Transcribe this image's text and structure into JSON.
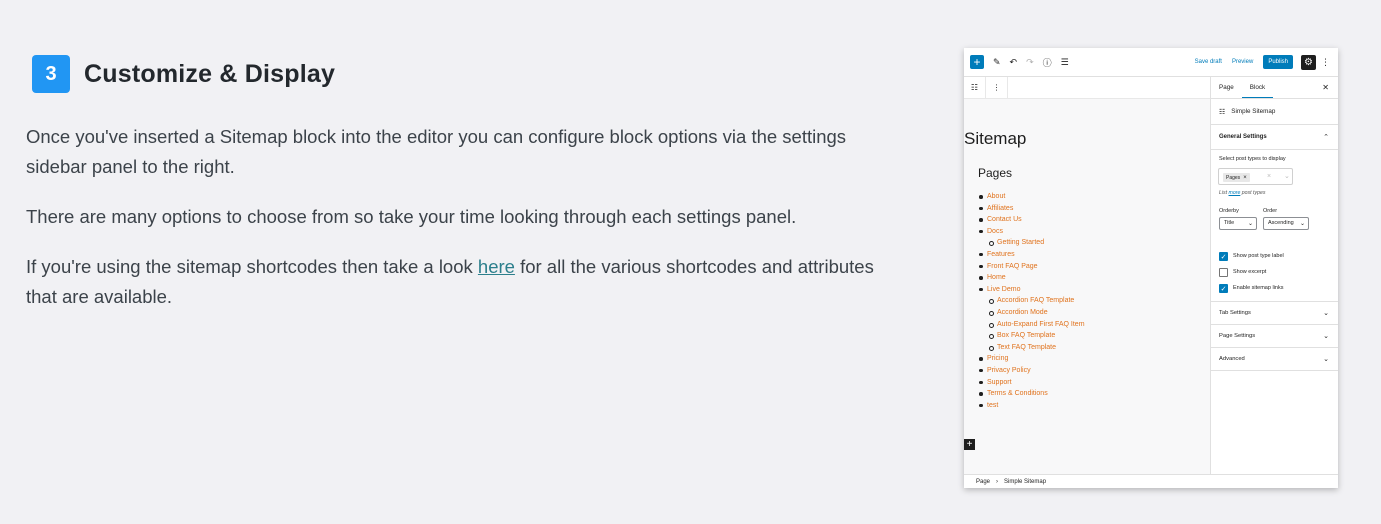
{
  "step": {
    "number": "3",
    "title": "Customize & Display"
  },
  "article": {
    "p1": "Once you've inserted a Sitemap block into the editor you can configure block options via the settings sidebar panel to the right.",
    "p2": "There are many options to choose from so take your time looking through each settings panel.",
    "p3_before": "If you're using the sitemap shortcodes then take a look ",
    "p3_link": "here",
    "p3_after": " for all the various shortcodes and attributes that are available."
  },
  "editor": {
    "toolbar": {
      "save_draft": "Save draft",
      "preview": "Preview",
      "publish": "Publish"
    },
    "canvas": {
      "title": "Sitemap",
      "subtitle": "Pages",
      "items": [
        {
          "label": "About",
          "sub": false
        },
        {
          "label": "Affiliates",
          "sub": false
        },
        {
          "label": "Contact Us",
          "sub": false
        },
        {
          "label": "Docs",
          "sub": false
        },
        {
          "label": "Getting Started",
          "sub": true
        },
        {
          "label": "Features",
          "sub": false
        },
        {
          "label": "Front FAQ Page",
          "sub": false
        },
        {
          "label": "Home",
          "sub": false
        },
        {
          "label": "Live Demo",
          "sub": false
        },
        {
          "label": "Accordion FAQ Template",
          "sub": true
        },
        {
          "label": "Accordion Mode",
          "sub": true
        },
        {
          "label": "Auto-Expand First FAQ Item",
          "sub": true
        },
        {
          "label": "Box FAQ Template",
          "sub": true
        },
        {
          "label": "Text FAQ Template",
          "sub": true
        },
        {
          "label": "Pricing",
          "sub": false
        },
        {
          "label": "Privacy Policy",
          "sub": false
        },
        {
          "label": "Support",
          "sub": false
        },
        {
          "label": "Terms & Conditions",
          "sub": false
        },
        {
          "label": "test",
          "sub": false
        }
      ]
    },
    "footer": {
      "crumb_root": "Page",
      "crumb_current": "Simple Sitemap"
    },
    "sidebar": {
      "tab_page": "Page",
      "tab_block": "Block",
      "block_name": "Simple Sitemap",
      "general_settings": "General Settings",
      "select_label": "Select post types to display",
      "token": "Pages",
      "hint_prefix": "List ",
      "hint_link": "more",
      "hint_suffix": " post types",
      "orderby_label": "Orderby",
      "orderby_value": "Title",
      "order_label": "Order",
      "order_value": "Ascending",
      "checkboxes": [
        {
          "label": "Show post type label",
          "checked": true
        },
        {
          "label": "Show excerpt",
          "checked": false
        },
        {
          "label": "Enable sitemap links",
          "checked": true
        }
      ],
      "tab_settings": "Tab Settings",
      "page_settings": "Page Settings",
      "advanced": "Advanced"
    }
  },
  "colors": {
    "badge": "#2196f3",
    "accent": "#007cba",
    "link_orange": "#e0731e",
    "article_link": "#2c7f8c"
  }
}
